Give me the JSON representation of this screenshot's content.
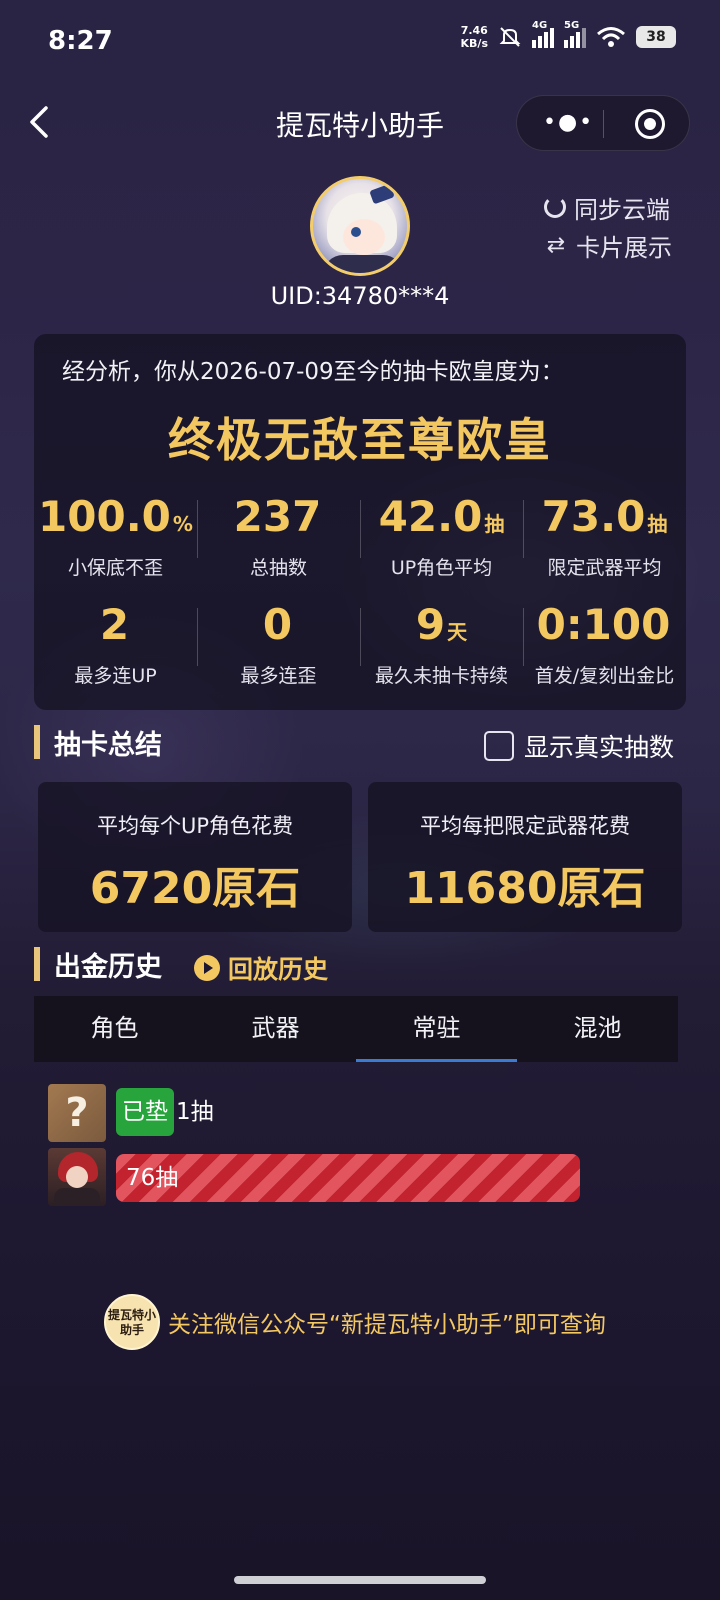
{
  "status_bar": {
    "time": "8:27",
    "net_speed_value": "7.46",
    "net_speed_unit": "KB/s",
    "signal_1_label": "4G",
    "signal_2_label": "5G",
    "battery": "38"
  },
  "header": {
    "title": "提瓦特小助手",
    "more_icon": "more-dots-icon",
    "target_icon": "target-icon"
  },
  "profile": {
    "uid": "UID:34780***4",
    "sync_label": "同步云端",
    "card_label": "卡片展示"
  },
  "analysis": {
    "intro": "经分析，你从2026-07-09至今的抽卡欧皇度为：",
    "rank_title": "终极无敌至尊欧皇",
    "stats": [
      {
        "value": "100.0",
        "unit": "%",
        "label": "小保底不歪"
      },
      {
        "value": "237",
        "unit": "",
        "label": "总抽数"
      },
      {
        "value": "42.0",
        "unit": "抽",
        "label": "UP角色平均"
      },
      {
        "value": "73.0",
        "unit": "抽",
        "label": "限定武器平均"
      },
      {
        "value": "2",
        "unit": "",
        "label": "最多连UP"
      },
      {
        "value": "0",
        "unit": "",
        "label": "最多连歪"
      },
      {
        "value": "9",
        "unit": "天",
        "label": "最久未抽卡持续"
      },
      {
        "value": "0:100",
        "unit": "",
        "label": "首发/复刻出金比"
      }
    ]
  },
  "summary": {
    "title": "抽卡总结",
    "checkbox_label": "显示真实抽数",
    "cost_cards": [
      {
        "label": "平均每个UP角色花费",
        "value": "6720原石"
      },
      {
        "label": "平均每把限定武器花费",
        "value": "11680原石"
      }
    ]
  },
  "history": {
    "title": "出金历史",
    "replay_label": "回放历史",
    "tabs": [
      "角色",
      "武器",
      "常驻",
      "混池"
    ],
    "active_tab": "常驻",
    "pity_badge": "已垫",
    "pity_text": "1抽",
    "unknown_thumb": "?",
    "rows": [
      {
        "label": "76抽",
        "fill_pct": 100,
        "color": "#c3222f"
      }
    ]
  },
  "footer": {
    "logo_text": "提瓦特小助手",
    "follow_text": "关注微信公众号“新提瓦特小助手”即可查询"
  },
  "colors": {
    "accent_gold": "#f4c860",
    "tab_underline": "#3b7bd4",
    "pity_green": "#27a53c"
  }
}
